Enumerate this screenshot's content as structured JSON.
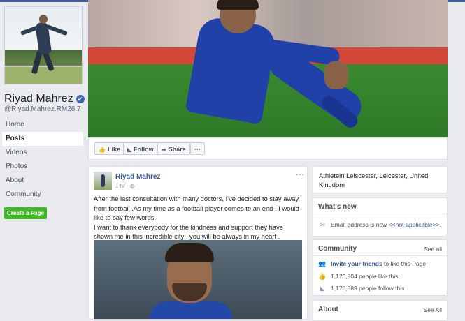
{
  "sidebar": {
    "page_name": "Riyad Mahrez",
    "handle": "@Riyad.Mahrez.RM26.7",
    "verified_icon": "✔",
    "nav": [
      "Home",
      "Posts",
      "Videos",
      "Photos",
      "About",
      "Community"
    ],
    "active_nav": "Posts",
    "create_page_label": "Create a Page"
  },
  "action_bar": {
    "like_label": "Like",
    "follow_label": "Follow",
    "share_label": "Share",
    "more_label": "···"
  },
  "post": {
    "author": "Riyad Mahrez",
    "time": "1 hr · ",
    "menu": "···",
    "paragraph1": "After the last consultation with many doctors, I've decided to stay away from football ,As my time as a football player comes to an end , I would like to say few words.",
    "paragraph2": "I want to thank everybody for the kindness and support they have shown me in this incredible city , you will be always in my heart ."
  },
  "right": {
    "address": "Athletein Leiscester, Leicester, United Kingdom",
    "whats_new_title": "What's new",
    "email_text": "Email address is now ",
    "email_value": "<<not-applicable>>",
    "email_end": ".",
    "community_title": "Community",
    "community_see_all": "See all",
    "invite_link": "Invite your friends",
    "invite_rest": " to like this Page",
    "likes_text": "1,170,804 people like this",
    "follows_text": "1,170,889 people follow this",
    "about_title": "About",
    "about_see_all": "See All"
  },
  "colors": {
    "facebook_blue": "#3b5998",
    "link_blue": "#365899",
    "create_green": "#42b72a",
    "background": "#e9ebee"
  }
}
